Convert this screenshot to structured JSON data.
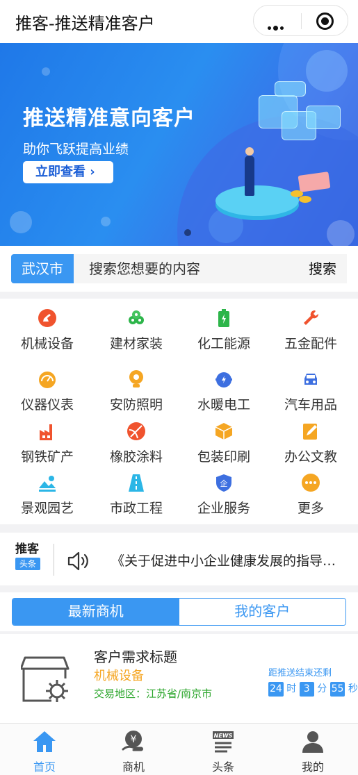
{
  "header": {
    "title": "推客-推送精准客户",
    "more_icon": "more-dots-icon",
    "close_icon": "target-close-icon"
  },
  "banner": {
    "headline": "推送精准意向客户",
    "subline": "助你飞跃提高业绩",
    "cta": "立即查看 ›"
  },
  "search": {
    "city": "武汉市",
    "placeholder": "搜索您想要的内容",
    "button": "搜索"
  },
  "categories": [
    {
      "label": "机械设备",
      "icon": "robot-arm-icon",
      "color": "#f0532e"
    },
    {
      "label": "建材家装",
      "icon": "bricks-icon",
      "color": "#2db54a"
    },
    {
      "label": "化工能源",
      "icon": "battery-icon",
      "color": "#2db54a"
    },
    {
      "label": "五金配件",
      "icon": "wrench-icon",
      "color": "#f0532e"
    },
    {
      "label": "仪器仪表",
      "icon": "gauge-icon",
      "color": "#f5a623"
    },
    {
      "label": "安防照明",
      "icon": "camera-icon",
      "color": "#f5a623"
    },
    {
      "label": "水暖电工",
      "icon": "plug-icon",
      "color": "#3d6fe0"
    },
    {
      "label": "汽车用品",
      "icon": "car-icon",
      "color": "#3d6fe0"
    },
    {
      "label": "钢铁矿产",
      "icon": "factory-icon",
      "color": "#f0532e"
    },
    {
      "label": "橡胶涂料",
      "icon": "ball-icon",
      "color": "#f0532e"
    },
    {
      "label": "包装印刷",
      "icon": "box-icon",
      "color": "#f5a623"
    },
    {
      "label": "办公文教",
      "icon": "pencil-note-icon",
      "color": "#f5a623"
    },
    {
      "label": "景观园艺",
      "icon": "landscape-icon",
      "color": "#2bb6e6"
    },
    {
      "label": "市政工程",
      "icon": "road-icon",
      "color": "#2bb6e6"
    },
    {
      "label": "企业服务",
      "icon": "shield-icon",
      "color": "#3d6fe0"
    },
    {
      "label": "更多",
      "icon": "more-icon",
      "color": "#f5a623"
    }
  ],
  "news": {
    "brand": "推客",
    "badge": "头条",
    "headline": "《关于促进中小企业健康发展的指导意见》",
    "icon": "speaker-icon"
  },
  "tabs": [
    {
      "label": "最新商机",
      "active": true
    },
    {
      "label": "我的客户",
      "active": false
    }
  ],
  "card": {
    "title": "客户需求标题",
    "category": "机械设备",
    "area": "交易地区：江苏省/南京市",
    "countdown_label": "距推送结束还剩",
    "hours": "24",
    "hours_unit": "时",
    "minutes": "3",
    "minutes_unit": "分",
    "seconds": "55",
    "seconds_unit": "秒"
  },
  "tabbar": [
    {
      "label": "首页",
      "icon": "home-icon",
      "active": true
    },
    {
      "label": "商机",
      "icon": "yuan-hand-icon",
      "active": false
    },
    {
      "label": "头条",
      "icon": "news-icon",
      "active": false
    },
    {
      "label": "我的",
      "icon": "user-icon",
      "active": false
    }
  ],
  "colors": {
    "primary": "#3a97f2",
    "orange": "#f5a623",
    "green": "#2aa52a"
  }
}
